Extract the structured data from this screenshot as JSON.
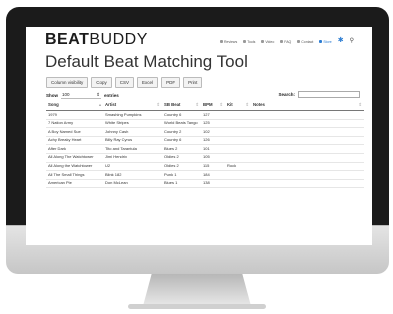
{
  "app": {
    "brand_bold": "BEAT",
    "brand_light": "BUDDY"
  },
  "nav": {
    "items": [
      {
        "label": "Reviews",
        "icon": "star-icon"
      },
      {
        "label": "Tools",
        "icon": "wrench-icon"
      },
      {
        "label": "Video",
        "icon": "video-icon"
      },
      {
        "label": "FAQ",
        "icon": "question-icon"
      },
      {
        "label": "Contact",
        "icon": "mail-icon"
      },
      {
        "label": "Store",
        "icon": "cart-icon"
      }
    ],
    "icons": [
      "beatbuddy-icon",
      "search-icon"
    ]
  },
  "page": {
    "title": "Default Beat Matching Tool"
  },
  "toolbar": {
    "buttons": [
      "Column visibility",
      "Copy",
      "CSV",
      "Excel",
      "PDF",
      "Print"
    ]
  },
  "show": {
    "label": "Show",
    "value": "100",
    "suffix": "entries"
  },
  "search": {
    "label": "Search:",
    "value": ""
  },
  "table": {
    "headers": [
      "Song",
      "Artist",
      "SB Beat",
      "BPM",
      "Kit",
      "Notes"
    ],
    "rows": [
      [
        "1979",
        "Smashing Pumpkins",
        "Country 6",
        "127",
        "",
        ""
      ],
      [
        "7 Nation Army",
        "White Stripes",
        "World Beats Tango",
        "125",
        "",
        ""
      ],
      [
        "A Boy Named Sue",
        "Johnny Cash",
        "Country 2",
        "102",
        "",
        ""
      ],
      [
        "Achy Breaky Heart",
        "Billy Ray Cyrus",
        "Country 6",
        "126",
        "",
        ""
      ],
      [
        "After Dark",
        "Tito and Tarantula",
        "Blues 2",
        "101",
        "",
        ""
      ],
      [
        "All Along The Watchtower",
        "Jimi Hendrix",
        "Oldies 2",
        "105",
        "",
        ""
      ],
      [
        "All Along the Watchtower",
        "U2",
        "Oldies 2",
        "115",
        "Rock",
        ""
      ],
      [
        "All The Small Things",
        "Blink 182",
        "Punk 1",
        "184",
        "",
        ""
      ],
      [
        "American Pie",
        "Don McLean",
        "Blues 1",
        "138",
        "",
        ""
      ]
    ]
  }
}
